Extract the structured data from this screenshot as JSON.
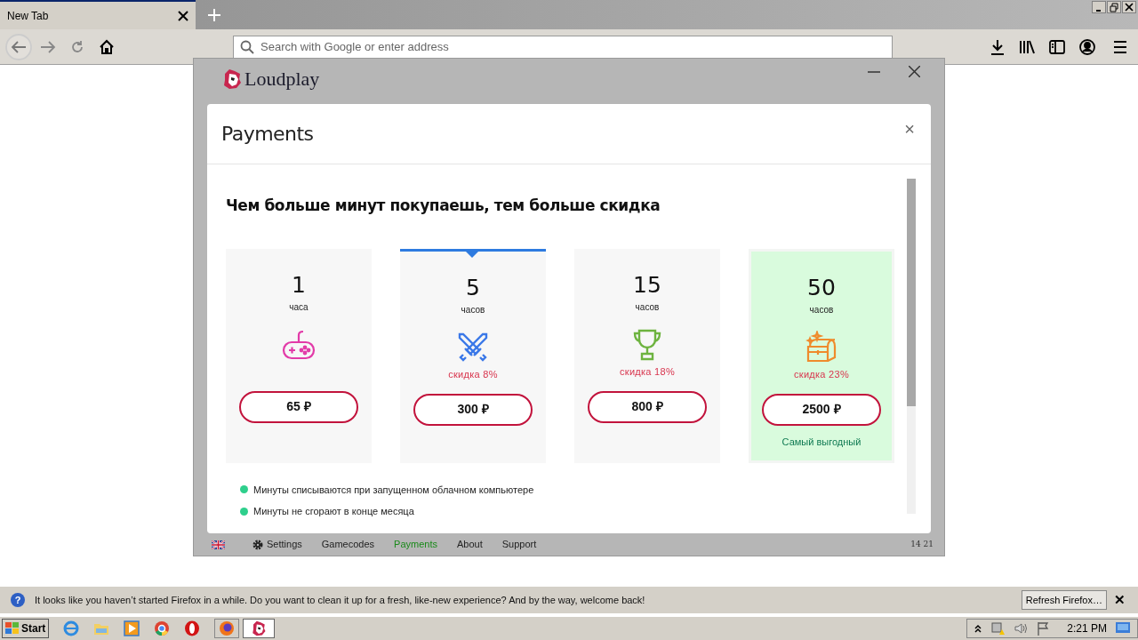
{
  "browser": {
    "tab": {
      "title": "New Tab"
    },
    "address": {
      "placeholder": "Search with Google or enter address"
    }
  },
  "app": {
    "title": "Loudplay",
    "modal": {
      "title": "Payments",
      "close": "×",
      "heading": "Чем больше минут покупаешь, тем больше скидка",
      "plans": [
        {
          "amount": "1",
          "unit": "часа",
          "price": "65 ₽",
          "selected": false,
          "highlighted": false
        },
        {
          "amount": "5",
          "unit": "часов",
          "discount": "скидка 8%",
          "price": "300 ₽",
          "selected": true,
          "highlighted": false
        },
        {
          "amount": "15",
          "unit": "часов",
          "discount": "скидка 18%",
          "price": "800 ₽",
          "selected": false,
          "highlighted": false
        },
        {
          "amount": "50",
          "unit": "часов",
          "discount": "скидка 23%",
          "price": "2500 ₽",
          "note": "Самый выгодный",
          "selected": false,
          "highlighted": true
        }
      ],
      "bullets": [
        "Минуты списываются при запущенном облачном компьютере",
        "Минуты не сгорают в конце месяца"
      ]
    },
    "footer": {
      "items": [
        {
          "label": "Settings",
          "selected": false
        },
        {
          "label": "Gamecodes",
          "selected": false
        },
        {
          "label": "Payments",
          "selected": true
        },
        {
          "label": "About",
          "selected": false
        },
        {
          "label": "Support",
          "selected": false
        }
      ],
      "version": "14 21"
    }
  },
  "notification": {
    "icon": "?",
    "message": "It looks like you haven’t started Firefox in a while. Do you want to clean it up for a fresh, like-new experience? And by the way, welcome back!",
    "button": "Refresh Firefox…",
    "close": "✕"
  },
  "taskbar": {
    "start": "Start",
    "clock": "2:21 PM"
  }
}
